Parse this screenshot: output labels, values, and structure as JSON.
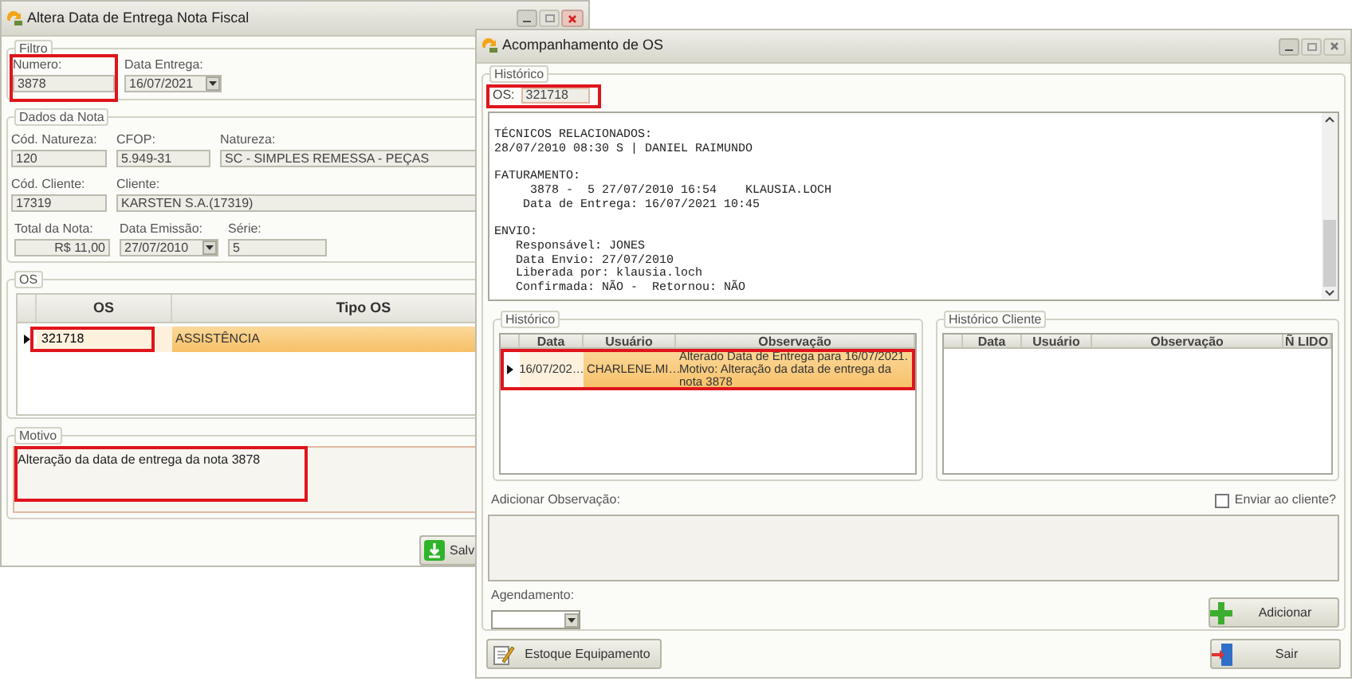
{
  "nota_window": {
    "title": "Altera Data de Entrega Nota Fiscal",
    "filtro": {
      "legend": "Filtro",
      "fields": [
        {
          "label": "Numero:",
          "value": "3878",
          "kind": "text",
          "highlighted": true
        },
        {
          "label": "Data Entrega:",
          "value": "16/07/2021",
          "kind": "combo",
          "highlighted": false
        }
      ]
    },
    "dados": {
      "legend": "Dados da Nota",
      "rows": [
        [
          {
            "label": "Cód. Natureza:",
            "value": "120",
            "kind": "text"
          },
          {
            "label": "CFOP:",
            "value": "5.949-31",
            "kind": "text"
          },
          {
            "label": "Natureza:",
            "value": "SC - SIMPLES REMESSA - PEÇAS",
            "kind": "text"
          }
        ],
        [
          {
            "label": "Cód. Cliente:",
            "value": "17319",
            "kind": "text"
          },
          {
            "label": "Cliente:",
            "value": "KARSTEN S.A.(17319)",
            "kind": "text"
          }
        ],
        [
          {
            "label": "Total da Nota:",
            "value": "R$ 11,00",
            "kind": "money"
          },
          {
            "label": "Data Emissão:",
            "value": "27/07/2010",
            "kind": "combo"
          },
          {
            "label": "Série:",
            "value": "5",
            "kind": "text"
          }
        ]
      ]
    },
    "os": {
      "legend": "OS",
      "columns": [
        "OS",
        "Tipo OS"
      ],
      "rows": [
        {
          "cells": [
            "321718",
            "ASSISTÊNCIA"
          ],
          "selected": true,
          "highlighted": true
        }
      ]
    },
    "motivo": {
      "legend": "Motivo",
      "value": "Alteração da data de entrega da nota 3878",
      "highlighted": true
    },
    "save_button": {
      "label": "Salv"
    }
  },
  "os_window": {
    "title": "Acompanhamento de OS",
    "historico": {
      "legend": "Histórico",
      "os_label": "OS:",
      "os_value": "321718",
      "highlighted": true,
      "log_blocks": [
        [
          "TÉCNICOS RELACIONADOS:",
          "28/07/2010 08:30 S | DANIEL RAIMUNDO"
        ],
        [
          "FATURAMENTO:",
          "     3878 -  5 27/07/2010 16:54    KLAUSIA.LOCH",
          "    Data de Entrega: 16/07/2021 10:45"
        ],
        [
          "ENVIO:",
          "   Responsável: JONES",
          "   Data Envio: 27/07/2010",
          "   Liberada por: klausia.loch",
          "   Confirmada: NÃO -  Retornou: NÃO"
        ]
      ]
    },
    "historico_grid": {
      "legend": "Histórico",
      "columns": [
        "Data",
        "Usuário",
        "Observação"
      ],
      "rows": [
        {
          "cells": [
            "16/07/202…",
            "CHARLENE.MI…",
            "Alterado Data de Entrega para 16/07/2021. Motivo: Alteração da data de entrega da nota 3878"
          ],
          "selected": true,
          "highlighted": true
        }
      ]
    },
    "cliente_grid": {
      "legend": "Histórico Cliente",
      "columns": [
        "Data",
        "Usuário",
        "Observação",
        "Ñ LIDO"
      ]
    },
    "observacao": {
      "label": "Adicionar Observação:"
    },
    "send_checkbox": {
      "label": "Enviar ao cliente?",
      "checked": false
    },
    "agendamento": {
      "label": "Agendamento:"
    },
    "add_button": {
      "label": "Adicionar"
    },
    "stock_button": {
      "label": "Estoque Equipamento"
    },
    "exit_button": {
      "label": "Sair"
    }
  }
}
